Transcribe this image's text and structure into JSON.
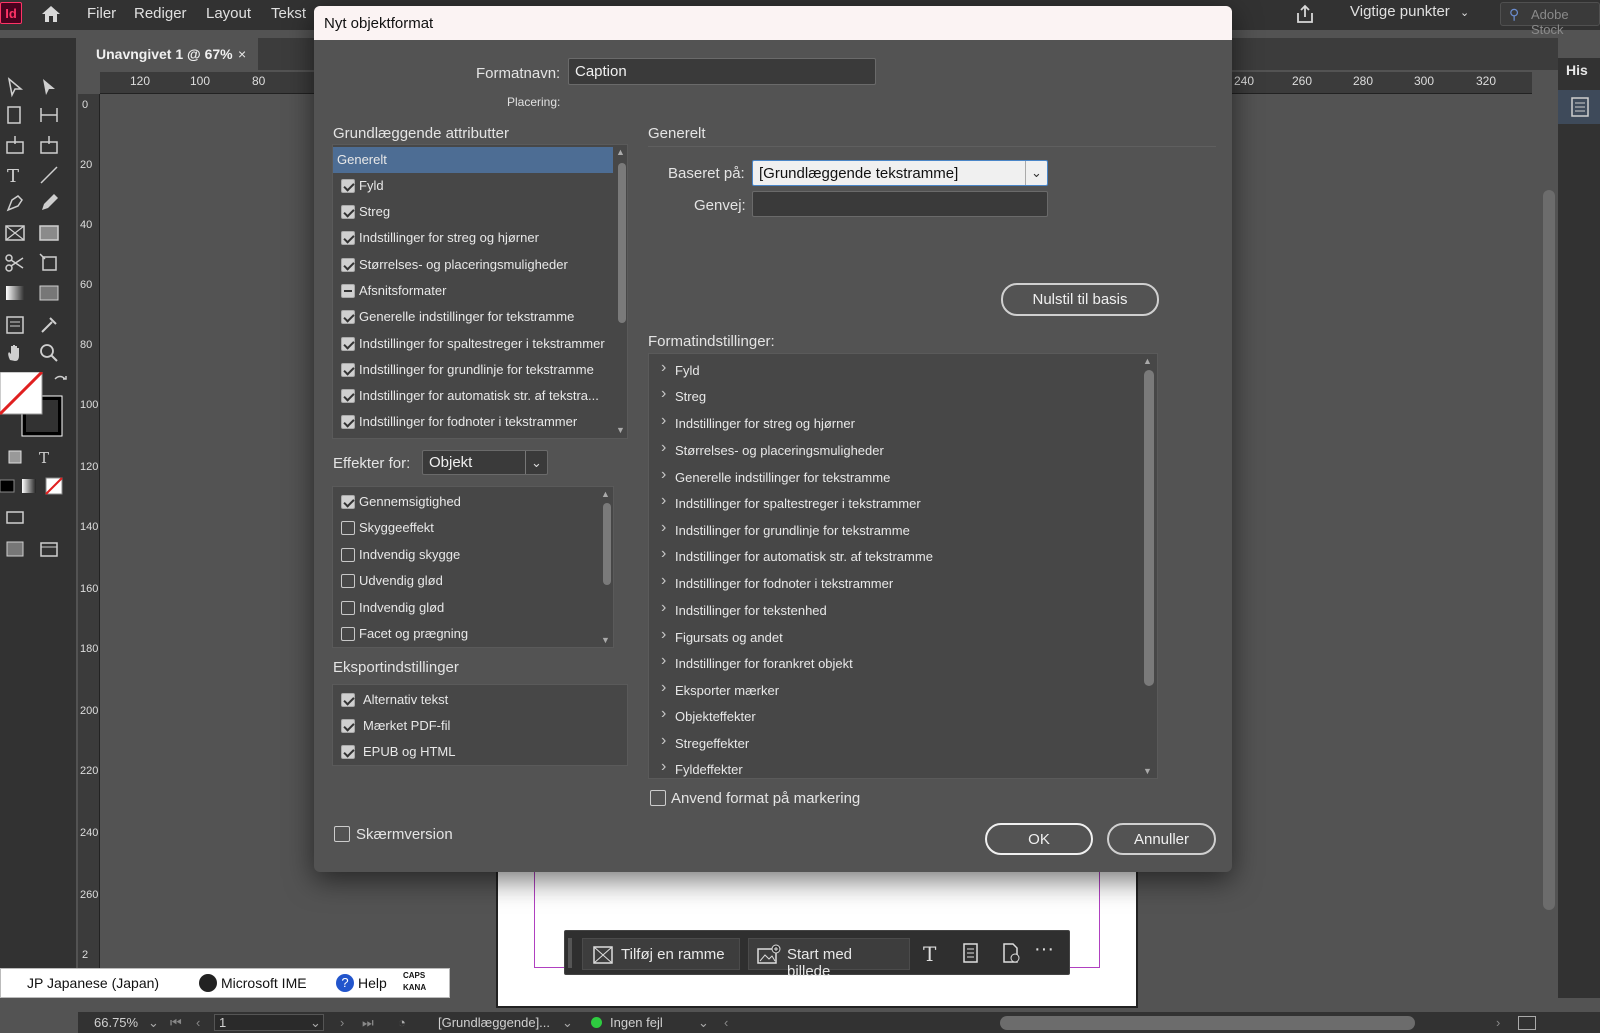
{
  "app": {
    "logo": "Id",
    "menu": [
      "Filer",
      "Rediger",
      "Layout",
      "Tekst"
    ],
    "workspace": "Vigtige punkter",
    "stock_search": "Adobe Stock"
  },
  "document": {
    "tab_title": "Unavngivet 1 @ 67%",
    "close": "×"
  },
  "rulers": {
    "h_left": [
      "120",
      "100",
      "80"
    ],
    "h_right": [
      "240",
      "260",
      "280",
      "300",
      "320"
    ],
    "v": [
      "0",
      "20",
      "40",
      "60",
      "80",
      "100",
      "120",
      "140",
      "160",
      "180",
      "200",
      "220",
      "240",
      "260",
      "2"
    ]
  },
  "right_panel": {
    "tab": "His"
  },
  "dialog": {
    "title": "Nyt objektformat",
    "format_name_label": "Formatnavn:",
    "format_name_value": "Caption",
    "placement_label": "Placering:",
    "basic_attrs_title": "Grundlæggende attributter",
    "basic_attrs": [
      {
        "label": "Generelt",
        "state": "selected"
      },
      {
        "label": "Fyld",
        "state": "on"
      },
      {
        "label": "Streg",
        "state": "on"
      },
      {
        "label": "Indstillinger for streg og hjørner",
        "state": "on"
      },
      {
        "label": "Størrelses- og placeringsmuligheder",
        "state": "on"
      },
      {
        "label": "Afsnitsformater",
        "state": "dash"
      },
      {
        "label": "Generelle indstillinger for tekstramme",
        "state": "on"
      },
      {
        "label": "Indstillinger for spaltestreger i tekstrammer",
        "state": "on"
      },
      {
        "label": "Indstillinger for grundlinje for tekstramme",
        "state": "on"
      },
      {
        "label": "Indstillinger for automatisk str. af tekstra...",
        "state": "on"
      },
      {
        "label": "Indstillinger for fodnoter i tekstrammer",
        "state": "on"
      }
    ],
    "effects_label": "Effekter for:",
    "effects_value": "Objekt",
    "effects": [
      {
        "label": "Gennemsigtighed",
        "state": "on"
      },
      {
        "label": "Skyggeeffekt",
        "state": "off"
      },
      {
        "label": "Indvendig skygge",
        "state": "off"
      },
      {
        "label": "Udvendig glød",
        "state": "off"
      },
      {
        "label": "Indvendig glød",
        "state": "off"
      },
      {
        "label": "Facet og prægning",
        "state": "off"
      }
    ],
    "export_title": "Eksportindstillinger",
    "export": [
      {
        "label": "Alternativ tekst",
        "state": "on"
      },
      {
        "label": "Mærket PDF-fil",
        "state": "on"
      },
      {
        "label": "EPUB og HTML",
        "state": "on"
      }
    ],
    "screen_version": "Skærmversion",
    "general_title": "Generelt",
    "based_on_label": "Baseret på:",
    "based_on_value": "[Grundlæggende tekstramme]",
    "shortcut_label": "Genvej:",
    "shortcut_value": "",
    "reset_button": "Nulstil til basis",
    "format_settings_title": "Formatindstillinger:",
    "format_settings": [
      "Fyld",
      "Streg",
      "Indstillinger for streg og hjørner",
      "Størrelses- og placeringsmuligheder",
      "Generelle indstillinger for tekstramme",
      "Indstillinger for spaltestreger i tekstrammer",
      "Indstillinger for grundlinje for tekstramme",
      "Indstillinger for automatisk str. af tekstramme",
      "Indstillinger for fodnoter i tekstrammer",
      "Indstillinger for tekstenhed",
      "Figursats og andet",
      "Indstillinger for forankret objekt",
      "Eksporter mærker",
      "Objekteffekter",
      "Stregeffekter",
      "Fyldeffekter"
    ],
    "apply_to_selection": "Anvend format på markering",
    "ok": "OK",
    "cancel": "Annuller"
  },
  "context_bar": {
    "add_frame": "Tilføj en ramme",
    "start_image": "Start med billede",
    "more": "···"
  },
  "ime": {
    "language": "JP Japanese (Japan)",
    "ime": "Microsoft IME",
    "help": "Help",
    "caps": "CAPS",
    "kana": "KANA"
  },
  "status": {
    "zoom": "66.75%",
    "page": "1",
    "style": "[Grundlæggende]...",
    "errors": "Ingen fejl"
  },
  "colors": {
    "accent_selected": "#4d6d94",
    "status_ok": "#2ecc40"
  }
}
